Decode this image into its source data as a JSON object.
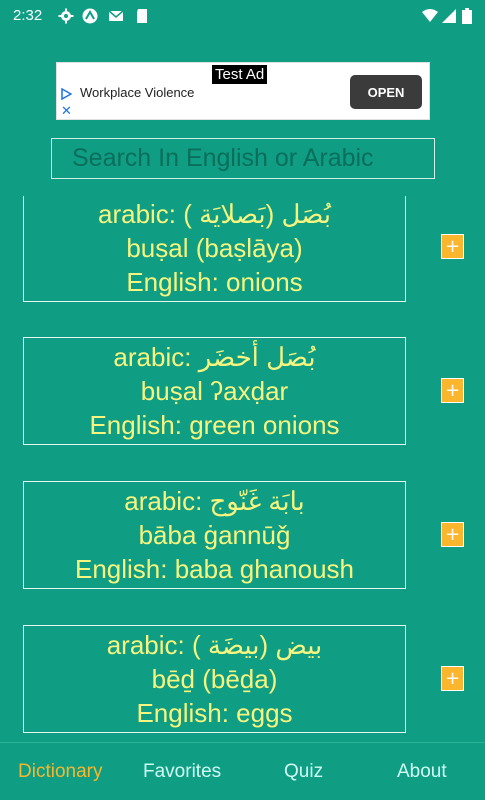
{
  "status_bar": {
    "time": "2:32",
    "icons": [
      "settings-icon",
      "android-icon",
      "mail-icon",
      "sd-card-icon",
      "wifi-icon",
      "signal-icon",
      "battery-icon"
    ]
  },
  "ad": {
    "tag": "Test Ad",
    "text": "Workplace Violence",
    "button": "OPEN"
  },
  "search": {
    "placeholder": "Search In English or Arabic"
  },
  "entries": [
    {
      "arabic_label": "arabic: ( بَصلايَة)  بُصَل",
      "translit": "buṣal (baṣlāya)",
      "english": "English: onions"
    },
    {
      "arabic_label": "arabic: بُصَل أخضَر",
      "translit": "buṣal ʔaxḍar",
      "english": "English: green onions"
    },
    {
      "arabic_label": "arabic: بابَة غَنّوج",
      "translit": "bāba ġannūǧ",
      "english": "English: baba ghanoush"
    },
    {
      "arabic_label": "arabic: ( بيضَة)  بيض",
      "translit": "bēḏ (bēḏa)",
      "english": "English: eggs"
    }
  ],
  "add_button_label": "+",
  "nav": {
    "items": [
      "Dictionary",
      "Favorites",
      "Quiz",
      "About"
    ],
    "active": "Dictionary"
  },
  "colors": {
    "background": "#0f9e83",
    "entry_text": "#f6f57f",
    "add_button": "#fbb62e",
    "nav_active": "#f7b72c",
    "nav_inactive": "#cffbf2"
  }
}
